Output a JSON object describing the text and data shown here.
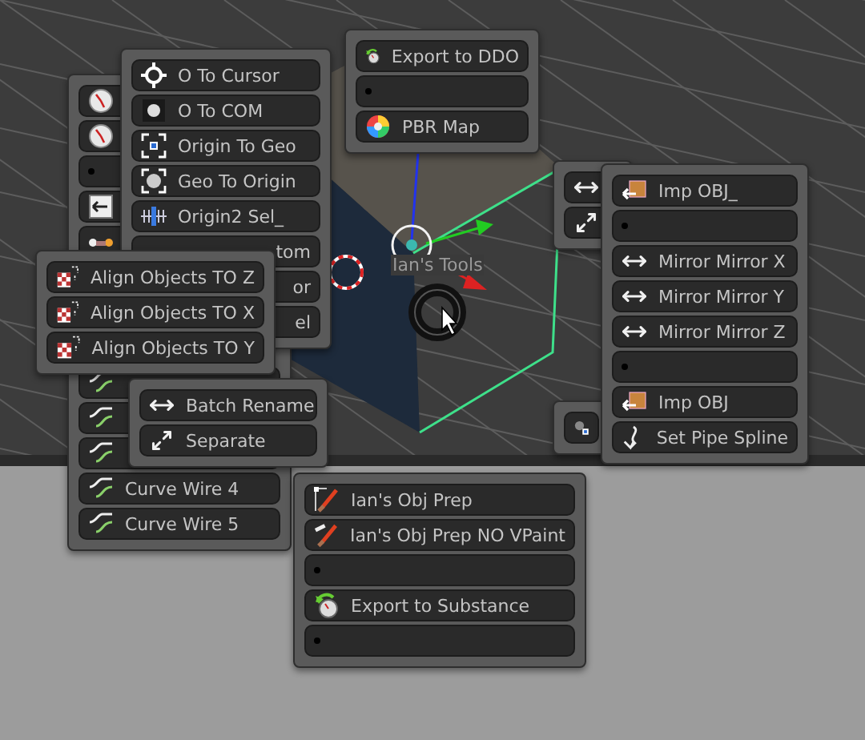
{
  "viewport": {
    "label": "Ian's Tools"
  },
  "menus": [
    {
      "items": [
        {
          "kind": "checker",
          "label": "Align Objects TO Z"
        },
        {
          "kind": "checker",
          "label": "Align Objects TO X"
        },
        {
          "kind": "checker",
          "label": "Align Objects TO Y"
        }
      ]
    },
    {
      "items": [
        {
          "kind": "clock"
        },
        {
          "kind": "clock"
        },
        {
          "kind": "dot"
        },
        {
          "kind": "import-arrow"
        },
        {
          "kind": "nodes"
        },
        {
          "kind": "curve"
        },
        {
          "kind": "curve"
        },
        {
          "kind": "curve"
        },
        {
          "kind": "curve",
          "label": "Curve Wire 4"
        },
        {
          "kind": "curve",
          "label": "Curve Wire 5"
        }
      ]
    },
    {
      "items": [
        {
          "kind": "crosshair",
          "label": "O To Cursor"
        },
        {
          "kind": "sphere",
          "label": "O To COM"
        },
        {
          "kind": "frame-dot",
          "label": "Origin To Geo"
        },
        {
          "kind": "frame-sphere",
          "label": "Geo To Origin"
        },
        {
          "kind": "bars",
          "label": "Origin2 Sel_"
        },
        {
          "kind": "partial",
          "label": "tom"
        },
        {
          "kind": "partial",
          "label": "or"
        },
        {
          "kind": "partial",
          "label": "el"
        }
      ]
    },
    {
      "items": [
        {
          "kind": "arrows",
          "label": "Batch Rename"
        },
        {
          "kind": "expand",
          "label": "Separate"
        }
      ]
    },
    {
      "items": [
        {
          "kind": "export",
          "label": "Export to DDO"
        },
        {
          "kind": "dot"
        },
        {
          "kind": "color-wheel",
          "label": "PBR Map"
        }
      ]
    },
    {
      "items": [
        {
          "kind": "brush",
          "label": "Ian's Obj Prep"
        },
        {
          "kind": "bone-brush",
          "label": "Ian's Obj Prep NO VPaint"
        },
        {
          "kind": "dot"
        },
        {
          "kind": "export",
          "label": "Export to Substance"
        },
        {
          "kind": "dot"
        }
      ]
    },
    {
      "items": [
        {
          "kind": "arrows"
        },
        {
          "kind": "expand"
        }
      ]
    },
    {
      "items": [
        {
          "kind": "origin-sphere"
        }
      ]
    },
    {
      "items": [
        {
          "kind": "box",
          "label": "Imp OBJ_"
        },
        {
          "kind": "dot"
        },
        {
          "kind": "arrows",
          "label": "Mirror Mirror X"
        },
        {
          "kind": "arrows",
          "label": "Mirror Mirror Y"
        },
        {
          "kind": "arrows",
          "label": "Mirror Mirror Z"
        },
        {
          "kind": "dot"
        },
        {
          "kind": "box",
          "label": "Imp OBJ"
        },
        {
          "kind": "hook",
          "label": "Set Pipe Spline"
        }
      ]
    }
  ]
}
